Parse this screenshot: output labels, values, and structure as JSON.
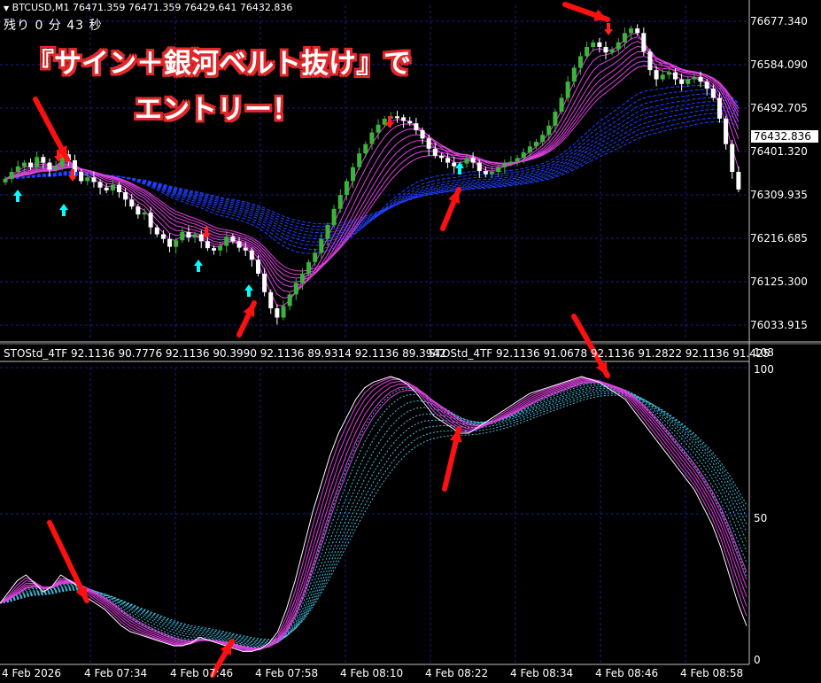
{
  "header": {
    "symbol_info": "BTCUSD,M1  76471.359 76471.359 76429.641 76432.836",
    "timer": "残り 0 分 43 秒"
  },
  "annotation": {
    "line1": "『サイン＋銀河ベルト抜け』で",
    "line2": "エントリー！"
  },
  "price_axis": {
    "labels": [
      "76677.340",
      "76584.090",
      "76492.705",
      "76401.320",
      "76309.935",
      "76216.685",
      "76125.300",
      "76033.915"
    ],
    "current_price": "76432.836"
  },
  "indicator": {
    "label_left": "STOStd_4TF 92.1136 90.7776 92.1136 90.3990 92.1136 89.9314 92.1136 89.3942",
    "label_right": "STOStd_4TF 92.1136 91.0678 92.1136 91.2822 92.1136 91.425",
    "axis_top": "108",
    "axis_100": "100",
    "axis_50": "50",
    "axis_0": "0"
  },
  "time_axis": {
    "labels": [
      "4 Feb 2026",
      "4 Feb 07:34",
      "4 Feb 07:46",
      "4 Feb 07:58",
      "4 Feb 08:10",
      "4 Feb 08:22",
      "4 Feb 08:34",
      "4 Feb 08:46",
      "4 Feb 08:58"
    ]
  },
  "colors": {
    "background": "#000000",
    "grid": "#1c1c8c",
    "bull_candle": "#3cb43c",
    "bear_candle": "#ffffff",
    "belt_magenta": "#e040e0",
    "belt_blue": "#2040ff",
    "belt_cyan": "#40c0e0",
    "signal_buy": "#00ffff",
    "signal_sell": "#ff2020",
    "arrow_red": "#ff1010"
  },
  "chart_data": [
    {
      "type": "candlestick",
      "title": "BTCUSD,M1",
      "ylim": [
        76000,
        76720
      ],
      "x_start": "4 Feb 2026 07:25",
      "candles_close": [
        76345,
        76360,
        76372,
        76380,
        76370,
        76392,
        76380,
        76365,
        76372,
        76398,
        76385,
        76360,
        76340,
        76348,
        76338,
        76326,
        76320,
        76332,
        76316,
        76300,
        76285,
        76268,
        76272,
        76240,
        76225,
        76215,
        76198,
        76212,
        76230,
        76218,
        76225,
        76210,
        76195,
        76190,
        76200,
        76220,
        76210,
        76196,
        76190,
        76170,
        76140,
        76100,
        76065,
        76045,
        76070,
        76095,
        76120,
        76140,
        76165,
        76185,
        76215,
        76245,
        76280,
        76310,
        76340,
        76370,
        76400,
        76420,
        76445,
        76462,
        76475,
        76480,
        76478,
        76470,
        76465,
        76450,
        76432,
        76410,
        76395,
        76390,
        76380,
        76372,
        76378,
        76390,
        76380,
        76362,
        76355,
        76360,
        76370,
        76378,
        76382,
        76390,
        76402,
        76415,
        76425,
        76440,
        76460,
        76490,
        76520,
        76555,
        76585,
        76610,
        76630,
        76640,
        76630,
        76618,
        76625,
        76640,
        76660,
        76670,
        76660,
        76620,
        76580,
        76560,
        76570,
        76575,
        76560,
        76550,
        76560,
        76565,
        76555,
        76540,
        76520,
        76475,
        76420,
        76360,
        76322
      ]
    },
    {
      "type": "line",
      "title": "STOStd_4TF",
      "ylim": [
        0,
        108
      ],
      "values": [
        20,
        24,
        28,
        30,
        27,
        24,
        26,
        30,
        28,
        26,
        22,
        20,
        18,
        15,
        12,
        10,
        9,
        8,
        7,
        6,
        5,
        5,
        6,
        8,
        7,
        6,
        5,
        4,
        3,
        3,
        4,
        6,
        10,
        18,
        28,
        40,
        52,
        62,
        72,
        80,
        86,
        92,
        96,
        98,
        99,
        100,
        99,
        97,
        94,
        90,
        86,
        84,
        82,
        80,
        80,
        82,
        84,
        86,
        88,
        90,
        92,
        94,
        95,
        96,
        97,
        98,
        99,
        100,
        99,
        98,
        96,
        94,
        92,
        88,
        84,
        80,
        76,
        72,
        68,
        64,
        60,
        54,
        48,
        40,
        30,
        20,
        12
      ]
    }
  ]
}
